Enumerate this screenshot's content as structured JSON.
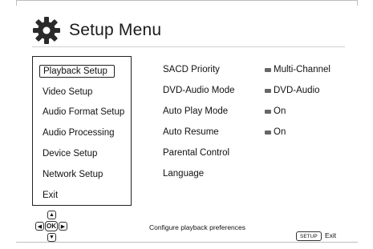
{
  "header": {
    "title": "Setup Menu",
    "icon": "gear-icon"
  },
  "menu": {
    "items": [
      {
        "label": "Playback Setup",
        "selected": true
      },
      {
        "label": "Video Setup",
        "selected": false
      },
      {
        "label": "Audio Format Setup",
        "selected": false
      },
      {
        "label": "Audio Processing",
        "selected": false
      },
      {
        "label": "Device Setup",
        "selected": false
      },
      {
        "label": "Network Setup",
        "selected": false
      },
      {
        "label": "Exit",
        "selected": false
      }
    ]
  },
  "options": [
    {
      "label": "SACD Priority",
      "value": "Multi-Channel"
    },
    {
      "label": "DVD-Audio Mode",
      "value": "DVD-Audio"
    },
    {
      "label": "Auto Play Mode",
      "value": "On"
    },
    {
      "label": "Auto Resume",
      "value": "On"
    },
    {
      "label": "Parental Control",
      "value": ""
    },
    {
      "label": "Language",
      "value": ""
    }
  ],
  "footer": {
    "dpad": {
      "up": "▲",
      "down": "▼",
      "left": "◀",
      "right": "▶",
      "ok": "OK"
    },
    "hint": "Configure playback preferences",
    "setup_key": "SETUP",
    "exit_label": "Exit"
  },
  "colors": {
    "gear": "#2a2a2a",
    "bullet": "#666666",
    "border": "#222222"
  }
}
